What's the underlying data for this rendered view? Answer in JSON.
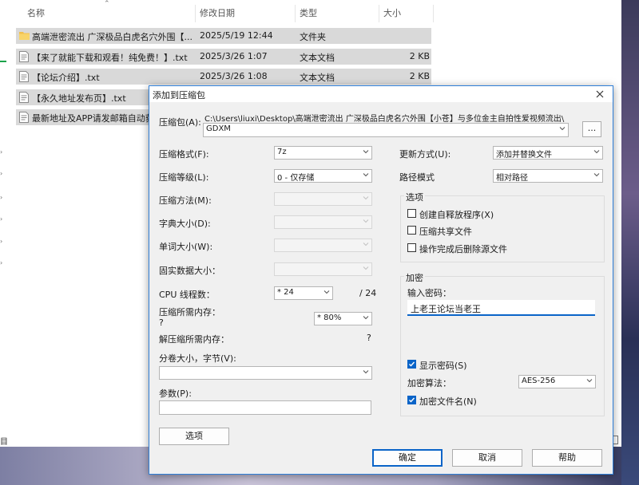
{
  "explorer": {
    "columns": {
      "name": "名称",
      "date": "修改日期",
      "type": "类型",
      "size": "大小"
    },
    "rows": [
      {
        "name": "高端泄密流出 广深极品白虎名穴外围【...",
        "date": "2025/5/19 12:44",
        "type": "文件夹",
        "size": "",
        "icon": "folder-icon"
      },
      {
        "name": "【来了就能下载和观看！纯免费！】.txt",
        "date": "2025/3/26 1:07",
        "type": "文本文档",
        "size": "2 KB",
        "icon": "text-file-icon"
      },
      {
        "name": "【论坛介绍】.txt",
        "date": "2025/3/26 1:08",
        "type": "文本文档",
        "size": "2 KB",
        "icon": "text-file-icon"
      },
      {
        "name": "【永久地址发布页】.txt",
        "date": "",
        "type": "",
        "size": "",
        "icon": "text-file-icon"
      },
      {
        "name": "最新地址及APP请发邮箱自动获",
        "date": "",
        "type": "",
        "size": "",
        "icon": "text-file-icon"
      }
    ],
    "status_text": "目"
  },
  "dialog": {
    "title": "添加到压缩包",
    "archive_label": "压缩包(A):",
    "archive_path": "C:\\Users\\liuxi\\Desktop\\高端泄密流出 广深极品白虎名穴外围【小苍】与多位金主自拍性爱视频流出\\",
    "archive_name": "GDXM",
    "browse_label": "...",
    "format_label": "压缩格式(F):",
    "format_value": "7z",
    "level_label": "压缩等级(L):",
    "level_value": "0 - 仅存储",
    "method_label": "压缩方法(M):",
    "dict_label": "字典大小(D):",
    "word_label": "单词大小(W):",
    "solid_label": "固实数据大小：",
    "cpu_label": "CPU 线程数：",
    "cpu_value": "* 24",
    "cpu_total": "/ 24",
    "mem_label": "压缩所需内存：",
    "mem_q": "?",
    "mem_value": "* 80%",
    "decomp_label": "解压缩所需内存：",
    "decomp_q": "?",
    "volume_label": "分卷大小，字节(V):",
    "params_label": "参数(P):",
    "options_button": "选项",
    "update_label": "更新方式(U):",
    "update_value": "添加并替换文件",
    "path_label": "路径模式",
    "path_value": "相对路径",
    "options_group": "选项",
    "opt_sfx": "创建自释放程序(X)",
    "opt_shared": "压缩共享文件",
    "opt_delete": "操作完成后删除源文件",
    "enc_group": "加密",
    "enc_pw_label": "输入密码：",
    "enc_pw_value": "上老王论坛当老王",
    "show_pw": "显示密码(S)",
    "enc_method_label": "加密算法：",
    "enc_method_value": "AES-256",
    "enc_names": "加密文件名(N)",
    "ok": "确定",
    "cancel": "取消",
    "help": "帮助"
  },
  "colors": {
    "accent": "#0a64c8",
    "folder": "#f2c04e",
    "selected_row": "#d9d9d9"
  }
}
